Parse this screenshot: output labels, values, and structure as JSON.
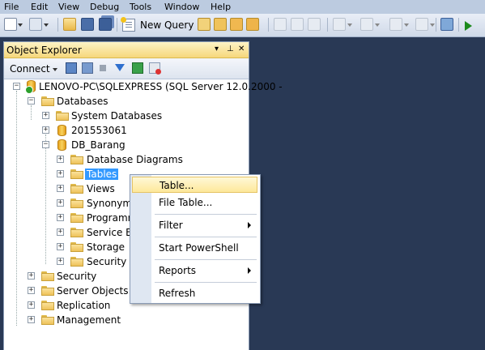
{
  "menu": [
    "File",
    "Edit",
    "View",
    "Debug",
    "Tools",
    "Window",
    "Help"
  ],
  "toolbar": {
    "new_query_label": "New Query"
  },
  "object_explorer": {
    "title": "Object Explorer",
    "title_controls": [
      "▾",
      "⊥",
      "✕"
    ],
    "connect_label": "Connect",
    "tree": [
      {
        "label": "LENOVO-PC\\SQLEXPRESS (SQL Server 12.0.2000 -",
        "icon": "server-icon",
        "expander": "−"
      },
      {
        "label": "Databases",
        "icon": "folder-icon",
        "expander": "−"
      },
      {
        "label": "System Databases",
        "icon": "folder-icon",
        "expander": "+"
      },
      {
        "label": "201553061",
        "icon": "database-icon",
        "expander": "+"
      },
      {
        "label": "DB_Barang",
        "icon": "database-icon",
        "expander": "−"
      },
      {
        "label": "Database Diagrams",
        "icon": "folder-icon",
        "expander": "+"
      },
      {
        "label": "Tables",
        "icon": "folder-icon",
        "expander": "+"
      },
      {
        "label": "Views",
        "icon": "folder-icon",
        "expander": "+"
      },
      {
        "label": "Synonyms",
        "icon": "folder-icon",
        "expander": "+"
      },
      {
        "label": "Programm",
        "icon": "folder-icon",
        "expander": "+"
      },
      {
        "label": "Service Bro",
        "icon": "folder-icon",
        "expander": "+"
      },
      {
        "label": "Storage",
        "icon": "folder-icon",
        "expander": "+"
      },
      {
        "label": "Security",
        "icon": "folder-icon",
        "expander": "+"
      },
      {
        "label": "Security",
        "icon": "folder-icon",
        "expander": "+"
      },
      {
        "label": "Server Objects",
        "icon": "folder-icon",
        "expander": "+"
      },
      {
        "label": "Replication",
        "icon": "folder-icon",
        "expander": "+"
      },
      {
        "label": "Management",
        "icon": "folder-icon",
        "expander": "+"
      }
    ]
  },
  "context_menu": {
    "items": [
      "Table...",
      "File Table...",
      "Filter",
      "Start PowerShell",
      "Reports",
      "Refresh"
    ]
  },
  "colors": {
    "workspace": "#293955",
    "panel_title": "#f6d77b",
    "selection": "#3399ff",
    "menu_highlight": "#fde89a"
  }
}
